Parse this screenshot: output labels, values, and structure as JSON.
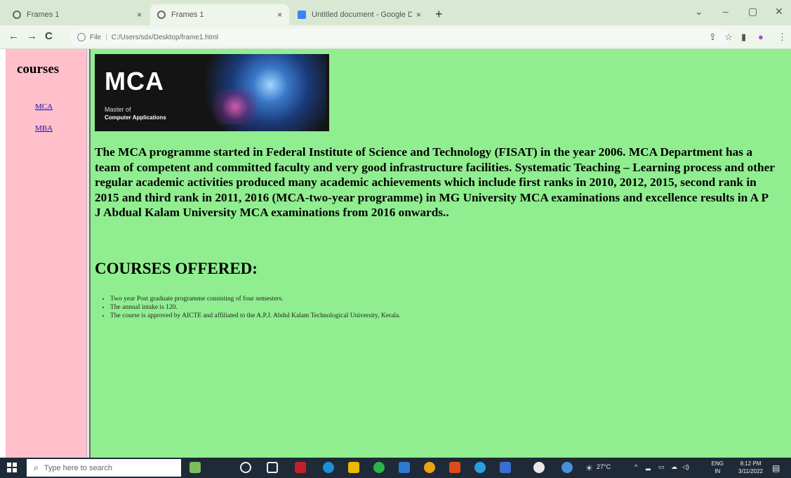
{
  "browser": {
    "tabs": [
      {
        "title": "Frames 1",
        "close": "×"
      },
      {
        "title": "Frames 1",
        "close": "×"
      },
      {
        "title": "Untitled document - Google Do",
        "close": "×"
      }
    ],
    "new_tab": "+",
    "window": {
      "dropdown": "⌄",
      "minimize": "–",
      "maximize": "▢",
      "close": "✕"
    },
    "nav": {
      "back": "←",
      "forward": "→",
      "reload": "C"
    },
    "address": {
      "scheme": "File",
      "path": "C:/Users/sdx/Desktop/frame1.html"
    }
  },
  "sidebar": {
    "heading": "courses",
    "links": [
      "MCA",
      "MBA"
    ]
  },
  "banner": {
    "title": "MCA",
    "line1": "Master of",
    "line2": "Computer Applications"
  },
  "main": {
    "intro": "The MCA programme started in Federal Institute of Science and Technology (FISAT) in the year 2006. MCA Department has a team of competent and committed faculty and very good infrastructure facilities. Systematic Teaching – Learning process and other regular academic activities produced many academic achievements which include first ranks in 2010, 2012, 2015, second rank in 2015 and third rank in 2011, 2016 (MCA-two-year programme) in MG University MCA examinations and excellence results in A P J Abdual Kalam University MCA examinations from 2016 onwards..",
    "courses_heading": "COURSES OFFERED:",
    "courses": [
      "Two year Post graduate programme consisting of four semesters.",
      "The annual intake is 120.",
      "The course is approved by AICTE and affiliated to the A.P.J. Abdul Kalam Technological University, Kerala."
    ]
  },
  "taskbar": {
    "search_placeholder": "Type here to search",
    "weather": "27°C",
    "lang": "ENG",
    "region": "IN",
    "time": "8:12 PM",
    "date": "3/11/2022"
  }
}
